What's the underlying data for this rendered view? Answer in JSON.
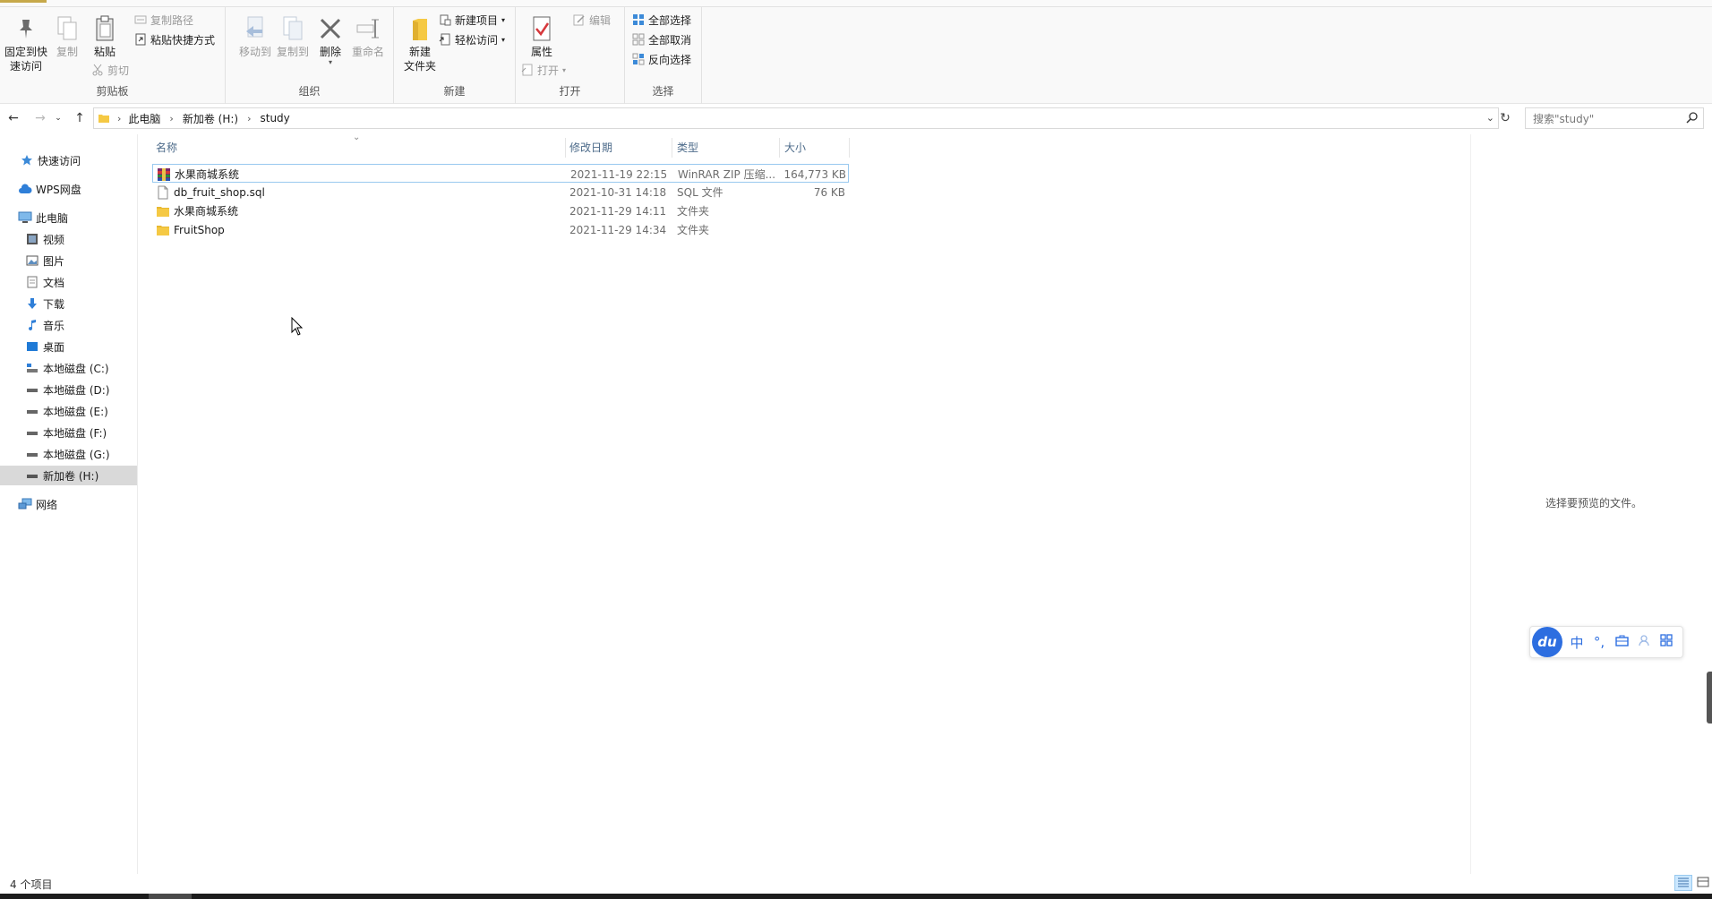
{
  "ribbon": {
    "clipboard": {
      "pin_label_1": "固定到快",
      "pin_label_2": "速访问",
      "copy_label": "复制",
      "paste_label": "粘贴",
      "copy_path_label": "复制路径",
      "paste_shortcut_label": "粘贴快捷方式",
      "cut_label": "剪切",
      "group_label": "剪贴板"
    },
    "organize": {
      "move_to_label": "移动到",
      "copy_to_label": "复制到",
      "delete_label": "删除",
      "rename_label": "重命名",
      "group_label": "组织"
    },
    "new": {
      "new_folder_label_1": "新建",
      "new_folder_label_2": "文件夹",
      "new_item_label": "新建项目",
      "easy_access_label": "轻松访问",
      "group_label": "新建"
    },
    "open": {
      "properties_label": "属性",
      "open_label": "打开",
      "edit_label": "编辑",
      "group_label": "打开"
    },
    "select": {
      "select_all_label": "全部选择",
      "select_none_label": "全部取消",
      "invert_label": "反向选择",
      "group_label": "选择"
    }
  },
  "address": {
    "crumbs": [
      "此电脑",
      "新加卷 (H:)",
      "study"
    ],
    "search_placeholder": "搜索\"study\""
  },
  "sidebar": {
    "items": [
      {
        "label": "快速访问",
        "icon": "star-icon"
      },
      {
        "label": "WPS网盘",
        "icon": "cloud-icon"
      },
      {
        "label": "此电脑",
        "icon": "computer-icon"
      },
      {
        "label": "视频",
        "icon": "video-icon"
      },
      {
        "label": "图片",
        "icon": "picture-icon"
      },
      {
        "label": "文档",
        "icon": "document-icon"
      },
      {
        "label": "下载",
        "icon": "download-icon"
      },
      {
        "label": "音乐",
        "icon": "music-icon"
      },
      {
        "label": "桌面",
        "icon": "desktop-icon"
      },
      {
        "label": "本地磁盘 (C:)",
        "icon": "drive-c-icon"
      },
      {
        "label": "本地磁盘 (D:)",
        "icon": "drive-icon"
      },
      {
        "label": "本地磁盘 (E:)",
        "icon": "drive-icon"
      },
      {
        "label": "本地磁盘 (F:)",
        "icon": "drive-icon"
      },
      {
        "label": "本地磁盘 (G:)",
        "icon": "drive-icon"
      },
      {
        "label": "新加卷 (H:)",
        "icon": "drive-icon"
      },
      {
        "label": "网络",
        "icon": "network-icon"
      }
    ]
  },
  "filelist": {
    "columns": {
      "name": "名称",
      "modified": "修改日期",
      "type": "类型",
      "size": "大小"
    },
    "rows": [
      {
        "name": "水果商城系统",
        "modified": "2021-11-19 22:15",
        "type": "WinRAR ZIP 压缩...",
        "size": "164,773 KB",
        "icon": "winrar-archive-icon"
      },
      {
        "name": "db_fruit_shop.sql",
        "modified": "2021-10-31 14:18",
        "type": "SQL 文件",
        "size": "76 KB",
        "icon": "file-icon"
      },
      {
        "name": "水果商城系统",
        "modified": "2021-11-29 14:11",
        "type": "文件夹",
        "size": "",
        "icon": "folder-icon"
      },
      {
        "name": "FruitShop",
        "modified": "2021-11-29 14:34",
        "type": "文件夹",
        "size": "",
        "icon": "folder-icon"
      }
    ]
  },
  "preview": {
    "message": "选择要预览的文件。"
  },
  "ime": {
    "logo": "du",
    "mode": "中",
    "punct": "°,"
  },
  "status": {
    "count": "4 个项目"
  },
  "colors": {
    "accent": "#c7a94a",
    "folder": "#f5c944",
    "selection_border": "#99c9ef",
    "ime_blue": "#2d6ee0"
  }
}
